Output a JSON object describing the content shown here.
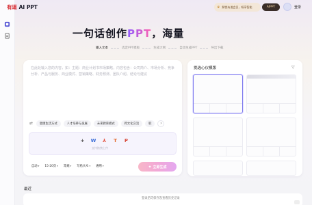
{
  "header": {
    "logo_brand": "有道",
    "logo_product": "AI PPT",
    "promo_text": "解锁有道会员，畅享智能",
    "promo_button": "AIPPT",
    "login_label": "登录"
  },
  "sidebar": {
    "items": [
      {
        "icon": "home-icon"
      },
      {
        "icon": "document-icon"
      }
    ]
  },
  "hero": {
    "prefix": "一句话创作",
    "highlight": "PPT",
    "suffix": "，海量"
  },
  "steps": [
    {
      "label": "输入文本",
      "active": true
    },
    {
      "label": "选定PPT模板",
      "active": false
    },
    {
      "label": "生成大纲",
      "active": false
    },
    {
      "label": "自动生成PPT",
      "active": false
    },
    {
      "label": "导出下载",
      "active": false
    }
  ],
  "input": {
    "placeholder": "在此处输入您的内容，如：主题：商业计划书市场策略，内容包含：公司简介、市场分析、竞争分析、产品与服务、商业模式、营销策略、财务预测、团队介绍、结论与建议"
  },
  "chips": [
    "健康生活方式",
    "人才培养与发展",
    "未来教育模式",
    "跨文化交流",
    "职"
  ],
  "upload": {
    "icons": [
      "plus-icon",
      "word-icon",
      "pdf-icon",
      "text-icon",
      "ppt-icon"
    ],
    "glyphs": [
      "+",
      "W",
      "⅄",
      "T",
      "P"
    ],
    "hint": "支持拖拽上传"
  },
  "options": [
    {
      "label": "自动"
    },
    {
      "label": "15-20页"
    },
    {
      "label": "常规"
    },
    {
      "label": "写给大众"
    },
    {
      "label": "通用"
    }
  ],
  "generate_button": "立即生成",
  "templates": {
    "title": "挑选心仪模版",
    "filter_icon": "filter-icon"
  },
  "recent": {
    "title": "最近",
    "empty_text": "登录后可保存及查看历史记录"
  },
  "colors": {
    "accent": "#7e7aee",
    "brand": "#d6262c"
  }
}
